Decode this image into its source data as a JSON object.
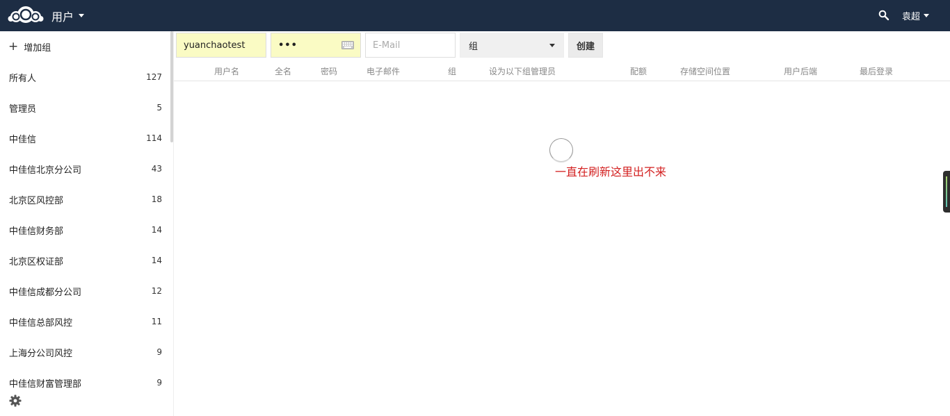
{
  "header": {
    "app_name": "用户",
    "user_name": "袁超",
    "colors": {
      "background": "#1d2d44",
      "text": "#ffffff"
    },
    "icons": [
      "cloud-logo-icon",
      "chevron-down-icon",
      "search-icon"
    ]
  },
  "sidebar": {
    "add_group_label": "增加组",
    "groups": [
      {
        "name": "所有人",
        "count": "127"
      },
      {
        "name": "管理员",
        "count": "5"
      },
      {
        "name": "中佳信",
        "count": "114"
      },
      {
        "name": "中佳信北京分公司",
        "count": "43"
      },
      {
        "name": "北京区风控部",
        "count": "18"
      },
      {
        "name": "中佳信财务部",
        "count": "14"
      },
      {
        "name": "北京区权证部",
        "count": "14"
      },
      {
        "name": "中佳信成都分公司",
        "count": "12"
      },
      {
        "name": "中佳信总部风控",
        "count": "11"
      },
      {
        "name": "上海分公司风控",
        "count": "9"
      },
      {
        "name": "中佳信财富管理部",
        "count": "9"
      }
    ],
    "icons": [
      "plus-icon",
      "gear-icon"
    ]
  },
  "form": {
    "username_value": "yuanchaotest",
    "password_value": "•••",
    "email_placeholder": "E-Mail",
    "group_select_label": "组",
    "create_label": "创建",
    "colors": {
      "autofill": "#fafbc4"
    }
  },
  "table": {
    "columns": [
      "用户名",
      "全名",
      "密码",
      "电子邮件",
      "组",
      "设为以下组管理员",
      "配额",
      "存储空间位置",
      "用户后端",
      "最后登录"
    ]
  },
  "annotation": {
    "text": "一直在刷新这里出不来",
    "color": "#d32020"
  }
}
